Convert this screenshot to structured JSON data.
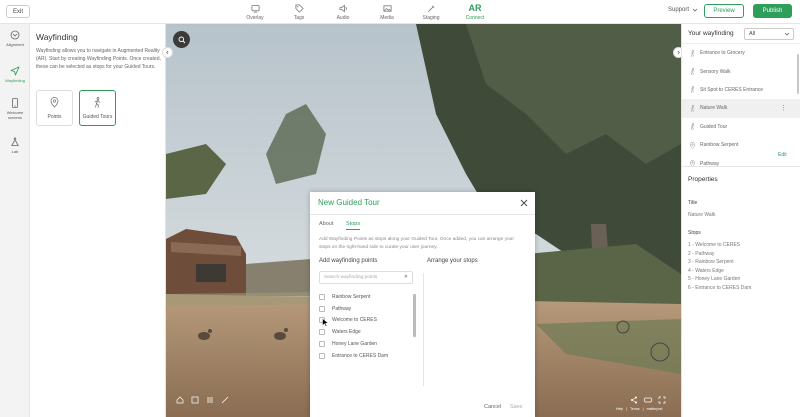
{
  "topbar": {
    "exit_label": "Exit",
    "nav": [
      {
        "label": "Overlay",
        "icon": "overlay-icon"
      },
      {
        "label": "Tags",
        "icon": "tag-icon"
      },
      {
        "label": "Audio",
        "icon": "audio-icon"
      },
      {
        "label": "Media",
        "icon": "media-icon"
      },
      {
        "label": "Staging",
        "icon": "staging-icon"
      },
      {
        "label": "Connect",
        "icon": "ar-connect-icon",
        "glyph": "AR",
        "active": true
      }
    ],
    "support_label": "Support",
    "preview_label": "Preview",
    "publish_label": "Publish",
    "accent_color": "#2e9e5b"
  },
  "rail": {
    "items": [
      {
        "label": "Alignment",
        "icon": "alignment-icon"
      },
      {
        "label": "Wayfinding",
        "icon": "navigation-arrow-icon",
        "active": true
      },
      {
        "label": "Welcome screens",
        "icon": "phone-icon"
      },
      {
        "label": "Lab",
        "icon": "flask-icon"
      }
    ]
  },
  "left_panel": {
    "title": "Wayfinding",
    "description": "Wayfinding allows you to navigate in Augmented Reality (AR). Start by creating Wayfinding Points. Once created, these can be selected as stops for your Guided Tours.",
    "cards": [
      {
        "label": "Points",
        "icon": "location-pin-icon"
      },
      {
        "label": "Guided Tours",
        "icon": "walking-person-icon",
        "active": true
      }
    ]
  },
  "viewer": {
    "help_label": "Help",
    "terms_label": "Terms",
    "brand_label": "matterport"
  },
  "right_panel": {
    "title": "Your wayfinding",
    "filter_value": "All",
    "items": [
      {
        "label": "Entrance to Grocery",
        "type": "tour"
      },
      {
        "label": "Sensory Walk",
        "type": "tour"
      },
      {
        "label": "Sit Spot to CERES Entrance",
        "type": "tour"
      },
      {
        "label": "Nature Walk",
        "type": "tour",
        "selected": true
      },
      {
        "label": "Guided Tour",
        "type": "tour"
      },
      {
        "label": "Rainbow Serpent",
        "type": "point"
      },
      {
        "label": "Pathway",
        "type": "point"
      }
    ],
    "properties": {
      "title": "Properties",
      "edit_label": "Edit",
      "title_label": "Title",
      "title_value": "Nature Walk",
      "stops_label": "Stops",
      "stops": [
        "1 - Welcome to CERES",
        "2 - Pathway",
        "3 - Rainbow Serpent",
        "4 - Waters Edge",
        "5 - Honey Lane Garden",
        "6 - Entrance to CERES Dam"
      ]
    }
  },
  "modal": {
    "title": "New Guided Tour",
    "tabs": [
      {
        "label": "About"
      },
      {
        "label": "Stops",
        "active": true
      }
    ],
    "description": "Add Wayfinding Points as stops along your Guided Tour. Once added, you can arrange your stops on the right-hand side to curate your user journey.",
    "add_title": "Add wayfinding points",
    "arrange_title": "Arrange your stops",
    "search_placeholder": "Search wayfinding points",
    "points": [
      "Rainbow Serpent",
      "Pathway",
      "Welcome to CERES",
      "Waters Edge",
      "Honey Lane Garden",
      "Entrance to CERES Dam"
    ],
    "cancel_label": "Cancel",
    "save_label": "Save"
  }
}
